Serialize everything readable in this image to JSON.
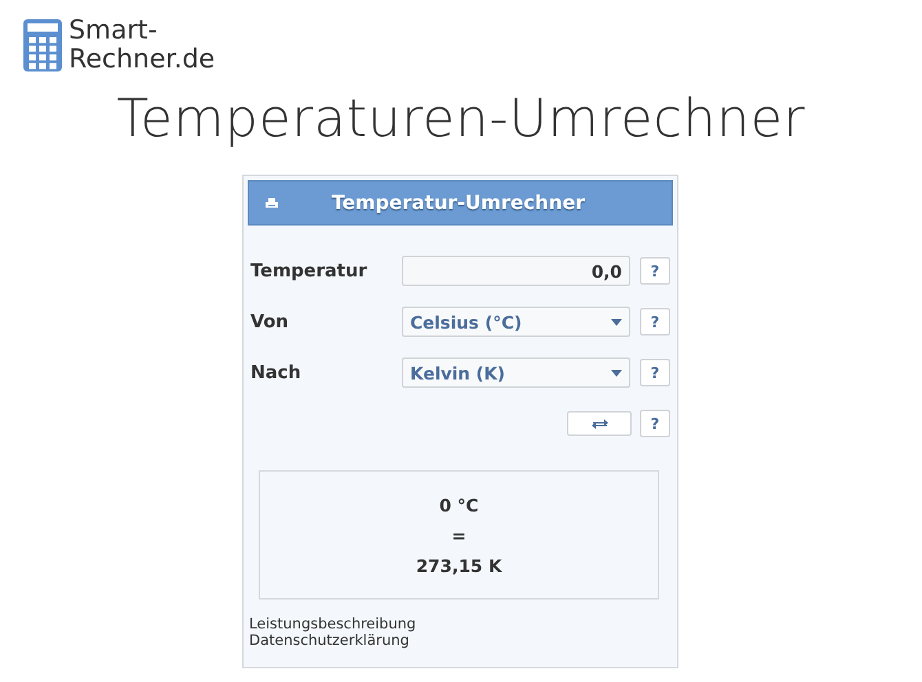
{
  "logo": {
    "line_1": "Smart-",
    "line_2": "Rechner.de"
  },
  "title": "Temperaturen-Umrechner",
  "calculator": {
    "header": "Temperatur-Umrechner",
    "rows": [
      {
        "kind": "input",
        "label": "Temperatur",
        "value": "0,0",
        "help": "?"
      },
      {
        "kind": "select",
        "label": "Von",
        "value": "Celsius (°C)",
        "help": "?"
      },
      {
        "kind": "select",
        "label": "Nach",
        "value": "Kelvin (K)",
        "help": "?"
      },
      {
        "kind": "swap",
        "help": "?"
      }
    ],
    "result": [
      "0 °C",
      "=",
      "273,15 K"
    ],
    "links": [
      "Leistungsbeschreibung",
      "Datenschutzerklärung"
    ]
  }
}
